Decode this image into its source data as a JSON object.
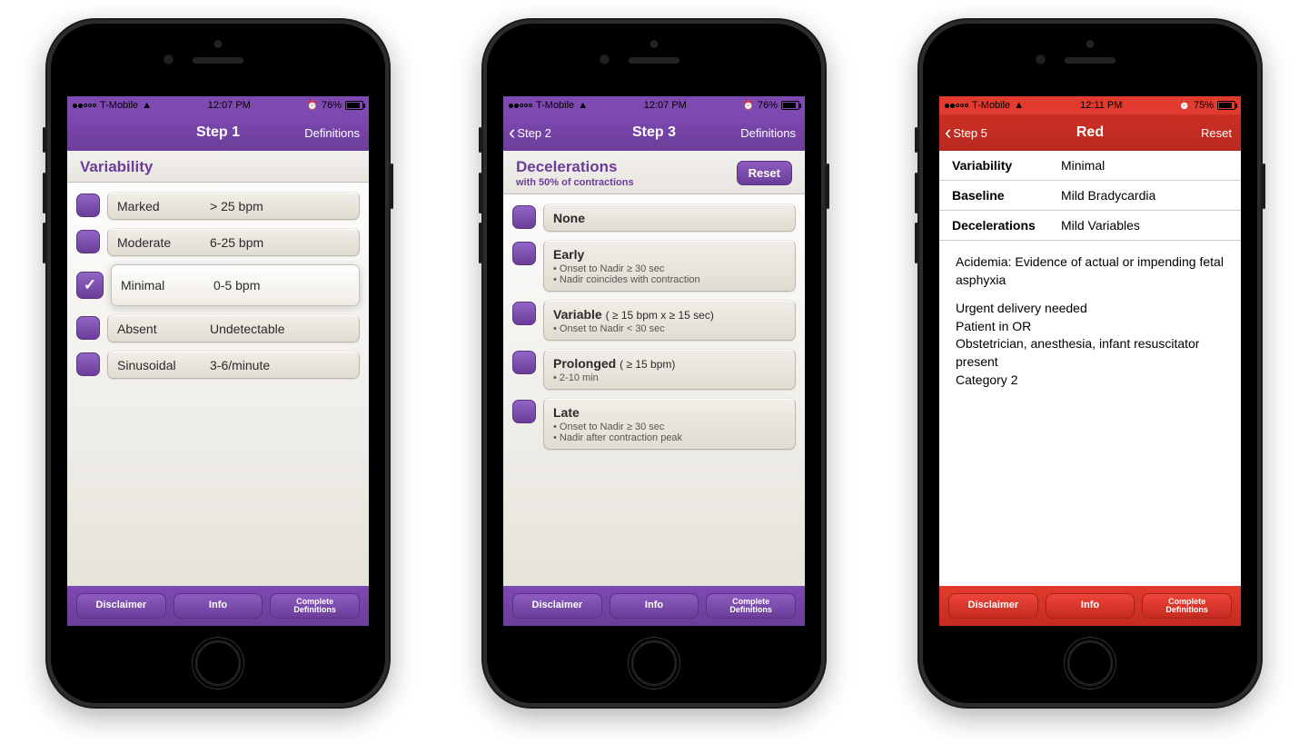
{
  "status": {
    "carrier": "T-Mobile",
    "time12": "12:07 PM",
    "time3": "12:11 PM",
    "battery12": "76%",
    "battery3": "75%"
  },
  "toolbar": {
    "disclaimer": "Disclaimer",
    "info": "Info",
    "complete": "Complete\nDefinitions"
  },
  "p1": {
    "nav_title": "Step 1",
    "nav_action": "Definitions",
    "section_title": "Variability",
    "options": [
      {
        "label": "Marked",
        "value": "> 25 bpm",
        "checked": false
      },
      {
        "label": "Moderate",
        "value": "6-25 bpm",
        "checked": false
      },
      {
        "label": "Minimal",
        "value": "0-5 bpm",
        "checked": true
      },
      {
        "label": "Absent",
        "value": "Undetectable",
        "checked": false
      },
      {
        "label": "Sinusoidal",
        "value": "3-6/minute",
        "checked": false
      }
    ]
  },
  "p2": {
    "nav_back": "Step 2",
    "nav_title": "Step 3",
    "nav_action": "Definitions",
    "section_title": "Decelerations",
    "section_sub": "with 50% of contractions",
    "reset_label": "Reset",
    "options": [
      {
        "label": "None",
        "extra": "",
        "bullets": []
      },
      {
        "label": "Early",
        "extra": "",
        "bullets": [
          "Onset to Nadir ≥ 30 sec",
          "Nadir coincides with contraction"
        ]
      },
      {
        "label": "Variable",
        "extra": "( ≥ 15 bpm x ≥ 15 sec)",
        "bullets": [
          "Onset to Nadir < 30 sec"
        ]
      },
      {
        "label": "Prolonged",
        "extra": "( ≥ 15 bpm)",
        "bullets": [
          "2-10 min"
        ]
      },
      {
        "label": "Late",
        "extra": "",
        "bullets": [
          "Onset to Nadir ≥ 30 sec",
          "Nadir after contraction peak"
        ]
      }
    ]
  },
  "p3": {
    "nav_back": "Step 5",
    "nav_title": "Red",
    "nav_action": "Reset",
    "rows": [
      {
        "k": "Variability",
        "v": "Minimal"
      },
      {
        "k": "Baseline",
        "v": "Mild Bradycardia"
      },
      {
        "k": "Decelerations",
        "v": "Mild Variables"
      }
    ],
    "msg1": "Acidemia: Evidence of actual or impending fetal asphyxia",
    "msg2": "Urgent delivery needed\nPatient in OR\nObstetrician, anesthesia, infant resuscitator present\nCategory 2"
  }
}
